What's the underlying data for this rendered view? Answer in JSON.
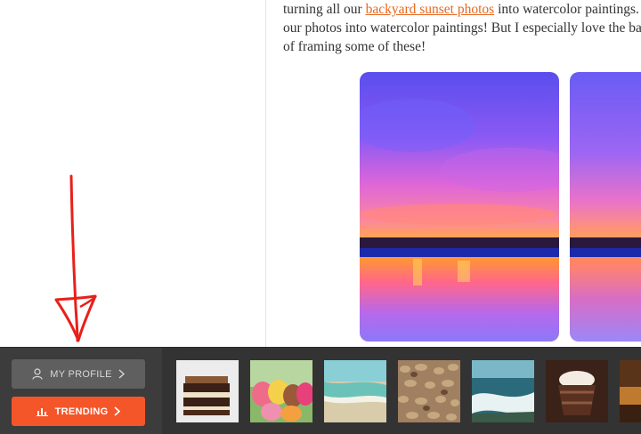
{
  "article": {
    "line1": {
      "before": "turning all our ",
      "link": "backyard sunset photos",
      "after": " into watercolor paintings. Wh"
    },
    "line2": "our photos into watercolor paintings! But I especially love the backyar",
    "line3": "of framing some of these!"
  },
  "bottom_bar": {
    "profile_label": "MY PROFILE",
    "trending_label": "TRENDING",
    "accent_color": "#f4562a",
    "thumbnails": [
      "chocolate-cake",
      "macarons",
      "beach-shore",
      "pebbles",
      "ocean-waves",
      "chocolate-pudding",
      "chocolate-dessert"
    ]
  }
}
